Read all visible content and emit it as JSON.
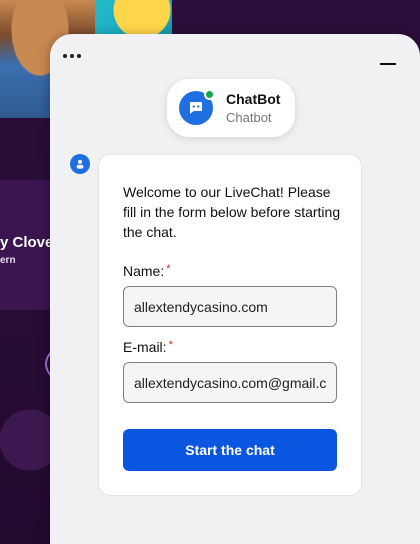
{
  "background": {
    "promo_title": "y Clover",
    "promo_subtitle": "ern"
  },
  "chat": {
    "header": {
      "menu_icon": "more-dots-icon",
      "minimize_icon": "minimize-icon"
    },
    "bot": {
      "name": "ChatBot",
      "subtitle": "Chatbot",
      "status": "online",
      "status_color": "#1aa251"
    },
    "message": {
      "welcome": "Welcome to our LiveChat! Please fill in the form below before starting the chat."
    },
    "form": {
      "name_label": "Name:",
      "name_value": "allextendycasino.com",
      "email_label": "E-mail:",
      "email_value": "allextendycasino.com@gmail.com",
      "required_mark": "*",
      "submit_label": "Start the chat"
    },
    "colors": {
      "accent": "#0a56e0",
      "required": "#d22222"
    }
  }
}
